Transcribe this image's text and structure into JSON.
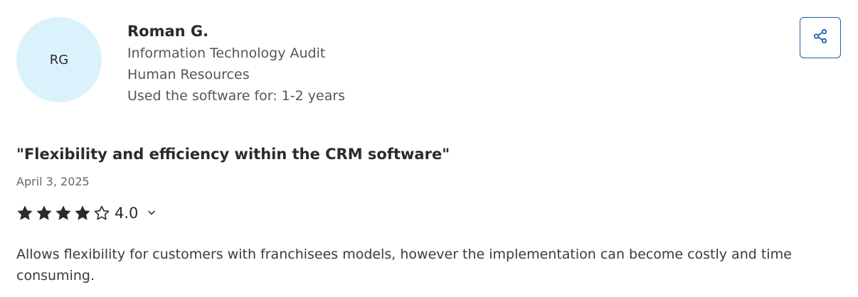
{
  "reviewer": {
    "initials": "RG",
    "name": "Roman G.",
    "industry": "Information Technology Audit",
    "department": "Human Resources",
    "usage": "Used the software for: 1-2 years"
  },
  "review": {
    "title": "\"Flexibility and efficiency within the CRM software\"",
    "date": "April 3, 2025",
    "rating": {
      "value_label": "4.0",
      "value": 4.0,
      "max": 5
    },
    "body": "Allows flexibility for customers with franchisees models, however the implementation can become costly and time consuming."
  },
  "icons": {
    "share": "share-icon",
    "star_filled": "star-filled-icon",
    "star_empty": "star-outline-icon",
    "chevron": "chevron-down-icon"
  },
  "colors": {
    "avatar_bg": "#daf2fb",
    "share_border": "#1f5fa8",
    "star": "#2b2b2b"
  }
}
